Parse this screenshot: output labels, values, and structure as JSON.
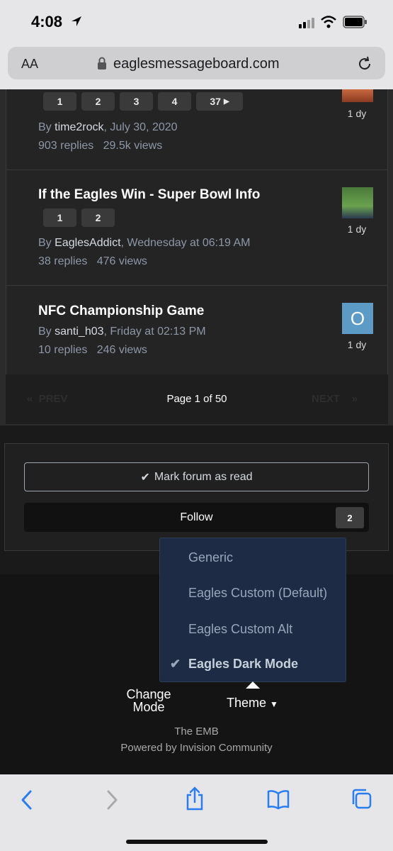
{
  "status_bar": {
    "time": "4:08"
  },
  "browser": {
    "text_size_label": "AA",
    "url": "eaglesmessageboard.com"
  },
  "topics": [
    {
      "pages": [
        "1",
        "2",
        "3",
        "4",
        "37"
      ],
      "author_prefix": "By ",
      "author": "time2rock",
      "date": ", July 30, 2020",
      "replies": "903 replies",
      "views": "29.5k views",
      "last_active": "1 dy"
    },
    {
      "title": "If the Eagles Win - Super Bowl Info",
      "pages": [
        "1",
        "2"
      ],
      "author_prefix": "By ",
      "author": "EaglesAddict",
      "date": ", Wednesday at 06:19 AM",
      "replies": "38 replies",
      "views": "476 views",
      "last_active": "1 dy"
    },
    {
      "title": "NFC Championship Game",
      "author_prefix": "By ",
      "author": "santi_h03",
      "date": ", Friday at 02:13 PM",
      "replies": "10 replies",
      "views": "246 views",
      "last_active": "1 dy",
      "avatar_letter": "O"
    }
  ],
  "pagination": {
    "prev": "PREV",
    "page_text": "Page 1 of 50",
    "next": "NEXT"
  },
  "actions": {
    "mark_read": "Mark forum as read",
    "follow": "Follow",
    "follow_count": "2"
  },
  "theme_menu": {
    "items": [
      {
        "label": "Generic",
        "selected": false
      },
      {
        "label": "Eagles Custom (Default)",
        "selected": false
      },
      {
        "label": "Eagles Custom Alt",
        "selected": false
      },
      {
        "label": "Eagles Dark Mode",
        "selected": true
      }
    ]
  },
  "footer": {
    "change_mode_line1": "Change",
    "change_mode_line2": "Mode",
    "theme": "Theme",
    "site_name": "The EMB",
    "powered_by": "Powered by Invision Community"
  },
  "colors": {
    "accent": "#2a7df0",
    "avatar_bg": "#5b9bc6",
    "menu_bg": "#1d2c44"
  }
}
